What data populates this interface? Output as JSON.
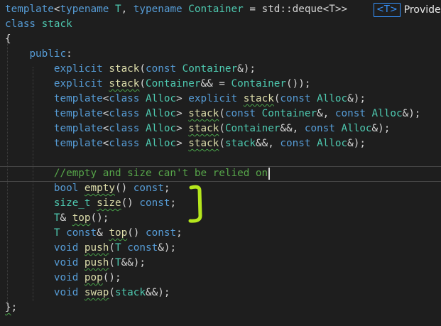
{
  "quick_info": {
    "badge": "<T>",
    "label": "Provide"
  },
  "comment_text": "//empty and size can't be relied on",
  "code_lines": [
    [
      {
        "t": "template",
        "c": "kw"
      },
      {
        "t": "<",
        "c": "pl"
      },
      {
        "t": "typename",
        "c": "kw"
      },
      {
        "t": " ",
        "c": "pl"
      },
      {
        "t": "T",
        "c": "ty"
      },
      {
        "t": ", ",
        "c": "pl"
      },
      {
        "t": "typename",
        "c": "kw"
      },
      {
        "t": " ",
        "c": "pl"
      },
      {
        "t": "Container",
        "c": "ty"
      },
      {
        "t": " = std::deque<T>>",
        "c": "pl"
      }
    ],
    [
      {
        "t": "class",
        "c": "kw"
      },
      {
        "t": " ",
        "c": "pl"
      },
      {
        "t": "stack",
        "c": "ty"
      }
    ],
    [
      {
        "t": "{",
        "c": "pl"
      }
    ],
    [
      {
        "t": "    ",
        "c": "pl"
      },
      {
        "t": "public",
        "c": "kw"
      },
      {
        "t": ":",
        "c": "pl"
      }
    ],
    [
      {
        "t": "        ",
        "c": "pl"
      },
      {
        "t": "explicit",
        "c": "kw"
      },
      {
        "t": " ",
        "c": "pl"
      },
      {
        "t": "stack",
        "c": "fn"
      },
      {
        "t": "(",
        "c": "pl"
      },
      {
        "t": "const",
        "c": "kw"
      },
      {
        "t": " ",
        "c": "pl"
      },
      {
        "t": "Container",
        "c": "ty"
      },
      {
        "t": "&);",
        "c": "pl"
      }
    ],
    [
      {
        "t": "        ",
        "c": "pl"
      },
      {
        "t": "explicit",
        "c": "kw"
      },
      {
        "t": " ",
        "c": "pl"
      },
      {
        "t": "stack",
        "c": "fn-sq"
      },
      {
        "t": "(",
        "c": "pl"
      },
      {
        "t": "Container",
        "c": "ty"
      },
      {
        "t": "&& = ",
        "c": "pl"
      },
      {
        "t": "Container",
        "c": "ty"
      },
      {
        "t": "());",
        "c": "pl"
      }
    ],
    [
      {
        "t": "        ",
        "c": "pl"
      },
      {
        "t": "template",
        "c": "kw"
      },
      {
        "t": "<",
        "c": "pl"
      },
      {
        "t": "class",
        "c": "kw"
      },
      {
        "t": " ",
        "c": "pl"
      },
      {
        "t": "Alloc",
        "c": "ty"
      },
      {
        "t": "> ",
        "c": "pl"
      },
      {
        "t": "explicit",
        "c": "kw"
      },
      {
        "t": " ",
        "c": "pl"
      },
      {
        "t": "stack",
        "c": "fn-sq"
      },
      {
        "t": "(",
        "c": "pl"
      },
      {
        "t": "const",
        "c": "kw"
      },
      {
        "t": " ",
        "c": "pl"
      },
      {
        "t": "Alloc",
        "c": "ty"
      },
      {
        "t": "&);",
        "c": "pl"
      }
    ],
    [
      {
        "t": "        ",
        "c": "pl"
      },
      {
        "t": "template",
        "c": "kw"
      },
      {
        "t": "<",
        "c": "pl"
      },
      {
        "t": "class",
        "c": "kw"
      },
      {
        "t": " ",
        "c": "pl"
      },
      {
        "t": "Alloc",
        "c": "ty"
      },
      {
        "t": "> ",
        "c": "pl"
      },
      {
        "t": "stack",
        "c": "fn-sq"
      },
      {
        "t": "(",
        "c": "pl"
      },
      {
        "t": "const",
        "c": "kw"
      },
      {
        "t": " ",
        "c": "pl"
      },
      {
        "t": "Container",
        "c": "ty"
      },
      {
        "t": "&, ",
        "c": "pl"
      },
      {
        "t": "const",
        "c": "kw"
      },
      {
        "t": " ",
        "c": "pl"
      },
      {
        "t": "Alloc",
        "c": "ty"
      },
      {
        "t": "&);",
        "c": "pl"
      }
    ],
    [
      {
        "t": "        ",
        "c": "pl"
      },
      {
        "t": "template",
        "c": "kw"
      },
      {
        "t": "<",
        "c": "pl"
      },
      {
        "t": "class",
        "c": "kw"
      },
      {
        "t": " ",
        "c": "pl"
      },
      {
        "t": "Alloc",
        "c": "ty"
      },
      {
        "t": "> ",
        "c": "pl"
      },
      {
        "t": "stack",
        "c": "fn-sq"
      },
      {
        "t": "(",
        "c": "pl"
      },
      {
        "t": "Container",
        "c": "ty"
      },
      {
        "t": "&&, ",
        "c": "pl"
      },
      {
        "t": "const",
        "c": "kw"
      },
      {
        "t": " ",
        "c": "pl"
      },
      {
        "t": "Alloc",
        "c": "ty"
      },
      {
        "t": "&);",
        "c": "pl"
      }
    ],
    [
      {
        "t": "        ",
        "c": "pl"
      },
      {
        "t": "template",
        "c": "kw"
      },
      {
        "t": "<",
        "c": "pl"
      },
      {
        "t": "class",
        "c": "kw"
      },
      {
        "t": " ",
        "c": "pl"
      },
      {
        "t": "Alloc",
        "c": "ty"
      },
      {
        "t": "> ",
        "c": "pl"
      },
      {
        "t": "stack",
        "c": "fn-sq"
      },
      {
        "t": "(",
        "c": "pl"
      },
      {
        "t": "stack",
        "c": "ty"
      },
      {
        "t": "&&, ",
        "c": "pl"
      },
      {
        "t": "const",
        "c": "kw"
      },
      {
        "t": " ",
        "c": "pl"
      },
      {
        "t": "Alloc",
        "c": "ty"
      },
      {
        "t": "&);",
        "c": "pl"
      }
    ],
    [],
    [
      {
        "t": "        ",
        "c": "pl"
      },
      {
        "t": "//empty and size can't be relied on",
        "c": "cm"
      },
      {
        "t": "|caret",
        "c": "caret"
      }
    ],
    [
      {
        "t": "        ",
        "c": "pl"
      },
      {
        "t": "bool",
        "c": "kw"
      },
      {
        "t": " ",
        "c": "pl"
      },
      {
        "t": "empty",
        "c": "fn-sq"
      },
      {
        "t": "() ",
        "c": "pl"
      },
      {
        "t": "const",
        "c": "kw"
      },
      {
        "t": ";",
        "c": "pl"
      }
    ],
    [
      {
        "t": "        ",
        "c": "pl"
      },
      {
        "t": "size_t",
        "c": "ty"
      },
      {
        "t": " ",
        "c": "pl"
      },
      {
        "t": "size",
        "c": "fn-sq"
      },
      {
        "t": "() ",
        "c": "pl"
      },
      {
        "t": "const",
        "c": "kw"
      },
      {
        "t": ";",
        "c": "pl"
      }
    ],
    [
      {
        "t": "        ",
        "c": "pl"
      },
      {
        "t": "T",
        "c": "ty"
      },
      {
        "t": "& ",
        "c": "pl"
      },
      {
        "t": "top",
        "c": "fn-sq"
      },
      {
        "t": "();",
        "c": "pl"
      }
    ],
    [
      {
        "t": "        ",
        "c": "pl"
      },
      {
        "t": "T",
        "c": "ty"
      },
      {
        "t": " ",
        "c": "pl"
      },
      {
        "t": "const",
        "c": "kw"
      },
      {
        "t": "& ",
        "c": "pl"
      },
      {
        "t": "top",
        "c": "fn-sq"
      },
      {
        "t": "() ",
        "c": "pl"
      },
      {
        "t": "const",
        "c": "kw"
      },
      {
        "t": ";",
        "c": "pl"
      }
    ],
    [
      {
        "t": "        ",
        "c": "pl"
      },
      {
        "t": "void",
        "c": "kw"
      },
      {
        "t": " ",
        "c": "pl"
      },
      {
        "t": "push",
        "c": "fn-sq"
      },
      {
        "t": "(",
        "c": "pl"
      },
      {
        "t": "T",
        "c": "ty"
      },
      {
        "t": " ",
        "c": "pl"
      },
      {
        "t": "const",
        "c": "kw"
      },
      {
        "t": "&);",
        "c": "pl"
      }
    ],
    [
      {
        "t": "        ",
        "c": "pl"
      },
      {
        "t": "void",
        "c": "kw"
      },
      {
        "t": " ",
        "c": "pl"
      },
      {
        "t": "push",
        "c": "fn-sq"
      },
      {
        "t": "(",
        "c": "pl"
      },
      {
        "t": "T",
        "c": "ty"
      },
      {
        "t": "&&);",
        "c": "pl"
      }
    ],
    [
      {
        "t": "        ",
        "c": "pl"
      },
      {
        "t": "void",
        "c": "kw"
      },
      {
        "t": " ",
        "c": "pl"
      },
      {
        "t": "pop",
        "c": "fn-sq"
      },
      {
        "t": "();",
        "c": "pl"
      }
    ],
    [
      {
        "t": "        ",
        "c": "pl"
      },
      {
        "t": "void",
        "c": "kw"
      },
      {
        "t": " ",
        "c": "pl"
      },
      {
        "t": "swap",
        "c": "fn-sq"
      },
      {
        "t": "(",
        "c": "pl"
      },
      {
        "t": "stack",
        "c": "ty"
      },
      {
        "t": "&&);",
        "c": "pl"
      }
    ],
    [
      {
        "t": "}",
        "c": "pl-sq"
      },
      {
        "t": ";",
        "c": "pl"
      }
    ]
  ],
  "colors": {
    "background": "#1e1e1e",
    "keyword": "#569cd6",
    "type": "#4ec9b0",
    "function": "#dcdcaa",
    "comment": "#57a64a",
    "squiggle": "#4aa54a",
    "annotation_bracket": "#b5e61d"
  }
}
